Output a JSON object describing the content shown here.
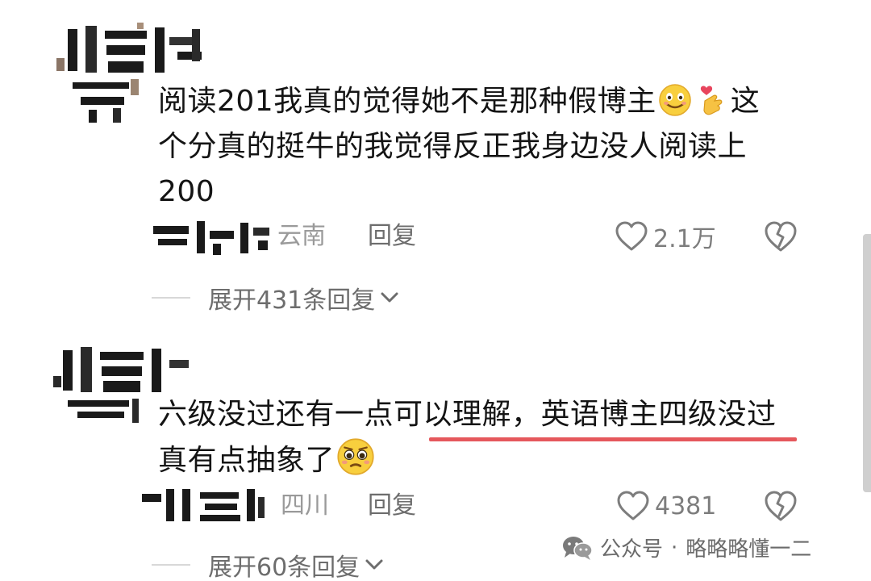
{
  "comments": [
    {
      "text_line1": "阅读201我真的觉得她不是那种假博主",
      "text_line1_tail": "这",
      "text_line2": "个分真的挺牛的我觉得反正我身边没人阅读上",
      "text_line3": "200",
      "emojis": [
        "smile-emoji",
        "finger-heart-emoji"
      ],
      "location": "云南",
      "reply_label": "回复",
      "likes": "2.1万",
      "expand_label": "展开431条回复"
    },
    {
      "text_line1": "六级没过还有一点可以理解，英语博主四级没过",
      "text_line2": "真有点抽象了",
      "emojis": [
        "pleading-emoji"
      ],
      "location": "四川",
      "reply_label": "回复",
      "likes": "4381",
      "expand_label": "展开60条回复"
    }
  ],
  "watermark": {
    "source": "公众号",
    "separator": "·",
    "account": "略略略懂一二"
  },
  "colors": {
    "underline": "#e5585c",
    "meta_gray": "#9a9a9a",
    "text": "#141414"
  }
}
